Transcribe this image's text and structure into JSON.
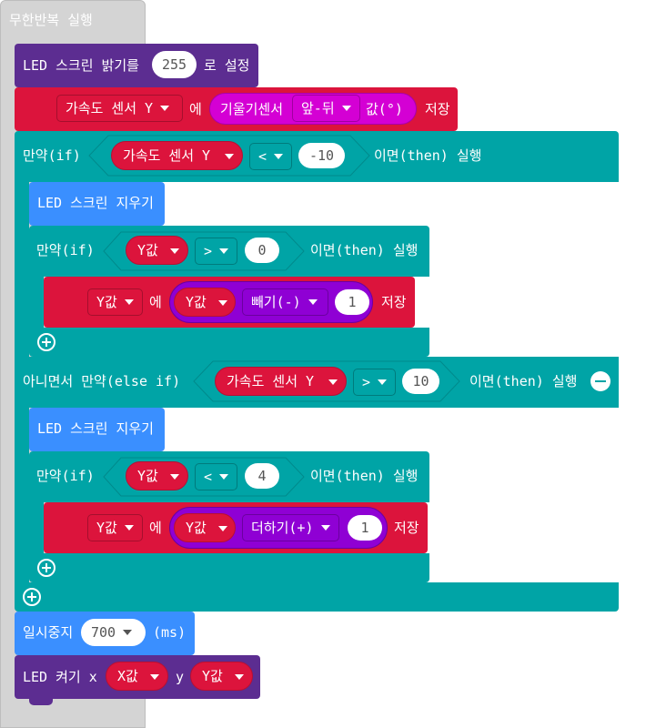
{
  "forever": {
    "label": "무한반복 실행"
  },
  "led_brightness": {
    "label": "LED 스크린 밝기를",
    "value": "255",
    "suffix": "로 설정"
  },
  "set_y": {
    "var": "가속도 센서 Y",
    "op": "에",
    "func": "기울기센서",
    "axis": "앞-뒤",
    "unit": "값(°)",
    "suffix": "저장"
  },
  "if1": {
    "kw": "만약(if)",
    "left": "가속도 센서 Y",
    "cmp": "<",
    "right": "-10",
    "then": "이면(then) 실행"
  },
  "clear1": {
    "label": "LED 스크린 지우기"
  },
  "if1_inner": {
    "kw": "만약(if)",
    "left": "Y값",
    "cmp": ">",
    "right": "0",
    "then": "이면(then) 실행"
  },
  "set_sub": {
    "var": "Y값",
    "op": "에",
    "left": "Y값",
    "func": "빼기(-)",
    "right": "1",
    "suffix": "저장"
  },
  "elseif": {
    "kw": "아니면서 만약(else if)",
    "left": "가속도 센서 Y",
    "cmp": ">",
    "right": "10",
    "then": "이면(then) 실행"
  },
  "clear2": {
    "label": "LED 스크린 지우기"
  },
  "if2_inner": {
    "kw": "만약(if)",
    "left": "Y값",
    "cmp": "<",
    "right": "4",
    "then": "이면(then) 실행"
  },
  "set_add": {
    "var": "Y값",
    "op": "에",
    "left": "Y값",
    "func": "더하기(+)",
    "right": "1",
    "suffix": "저장"
  },
  "pause": {
    "label": "일시중지",
    "value": "700",
    "unit": "(ms)"
  },
  "plot": {
    "label": "LED 켜기 x",
    "x": "X값",
    "ylabel": "y",
    "y": "Y값"
  },
  "colors": {
    "led": "#5c2d91",
    "variables": "#dc143c",
    "logic": "#00a4a6",
    "basic": "#3a8fff",
    "input": "#d400d4",
    "math": "#8f00d4",
    "loop_bg": "#d4d4d4"
  }
}
